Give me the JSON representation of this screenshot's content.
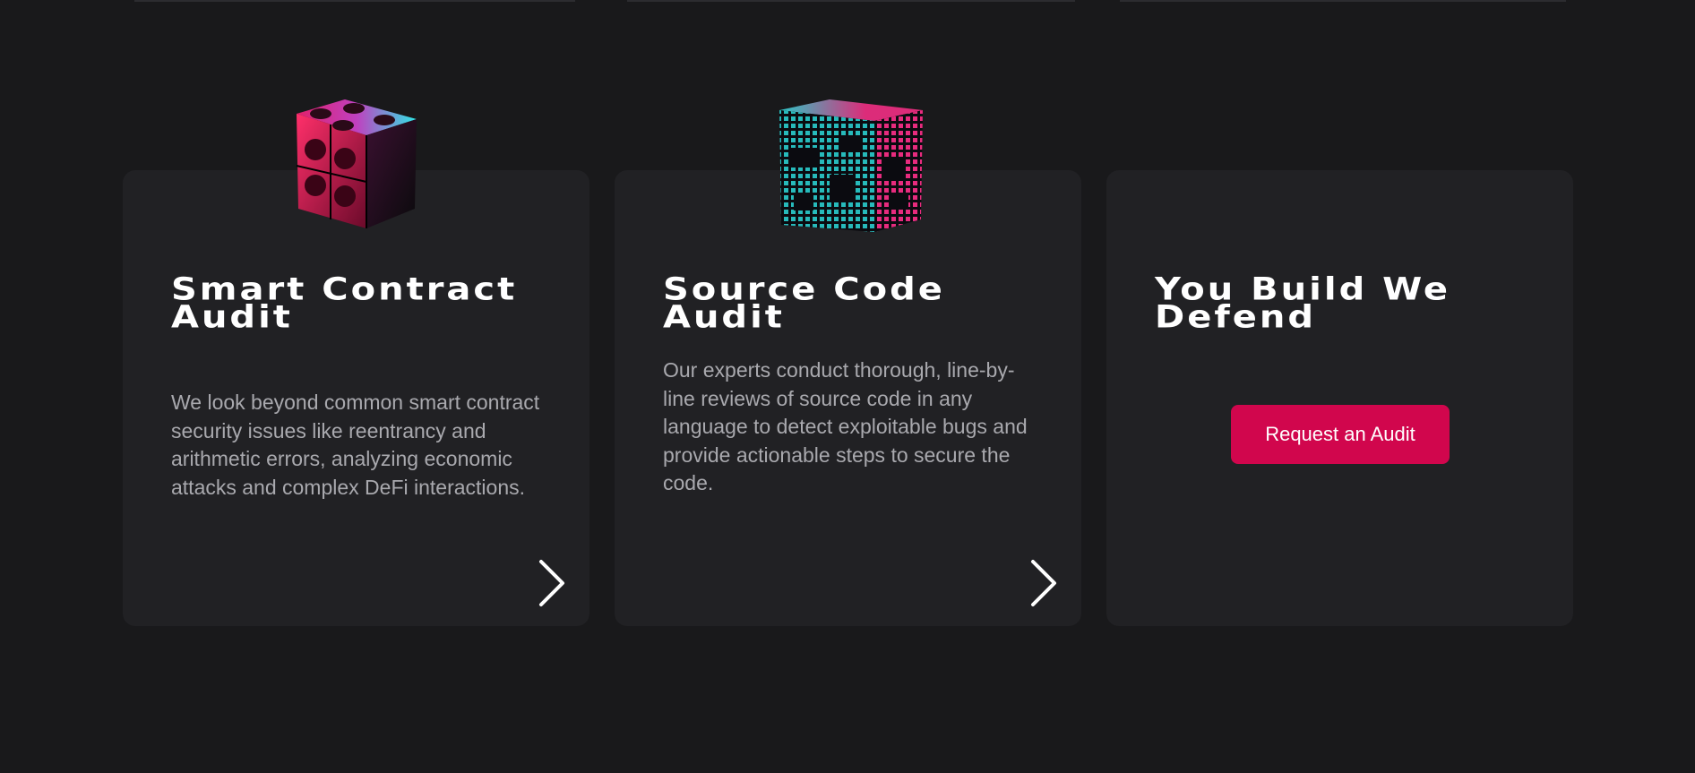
{
  "cards": [
    {
      "title": "Smart Contract Audit",
      "description": "We look beyond common smart contract security issues like reentrancy and arithmetic errors, analyzing economic attacks and complex DeFi interactions.",
      "icon": "chevron-right-icon"
    },
    {
      "title": "Source Code Audit",
      "description": "Our experts conduct thorough, line-by-line reviews of source code in any language to detect exploitable bugs and provide actionable steps to secure the code.",
      "icon": "chevron-right-icon"
    },
    {
      "title": "You Build We Defend",
      "button_label": "Request an Audit"
    }
  ],
  "colors": {
    "background": "#19191b",
    "card": "#212124",
    "accent": "#d1064d",
    "cube_pink": "#ff2f8a",
    "cube_cyan": "#2ee6e6"
  }
}
